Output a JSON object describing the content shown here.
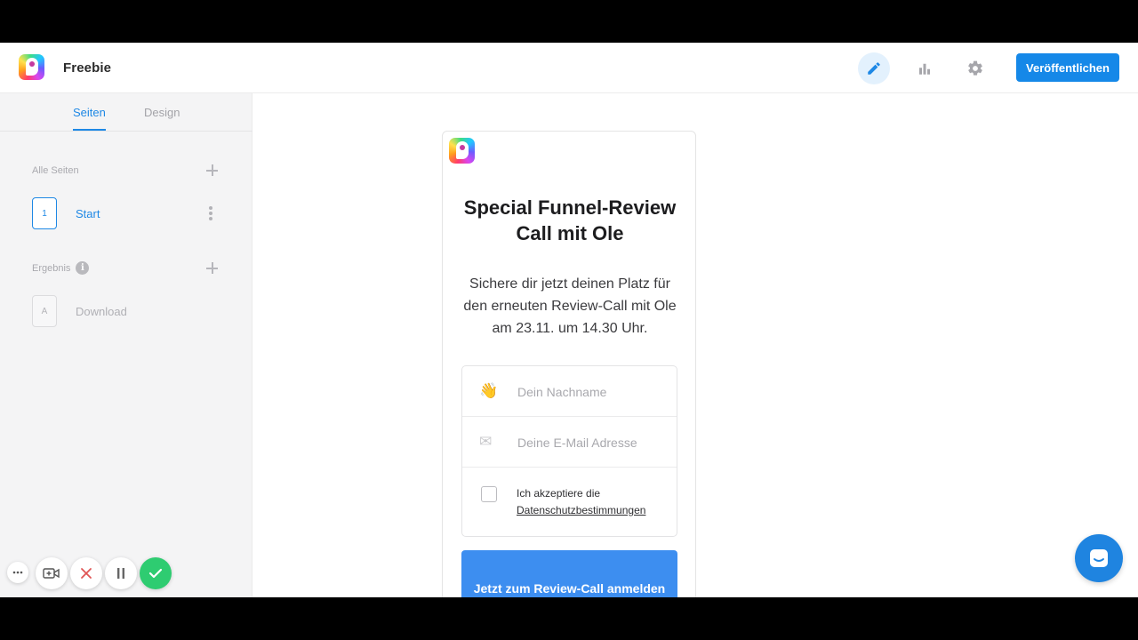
{
  "header": {
    "project_name": "Freebie",
    "publish_label": "Veröffentlichen",
    "icons": [
      "edit-icon",
      "chart-icon",
      "gear-icon"
    ],
    "accent": "#1588e8"
  },
  "sidebar": {
    "tabs": [
      {
        "label": "Seiten",
        "active": true
      },
      {
        "label": "Design",
        "active": false
      }
    ],
    "pages_section": {
      "label": "Alle Seiten"
    },
    "pages": [
      {
        "badge": "1",
        "label": "Start",
        "active": true
      }
    ],
    "result_section": {
      "label": "Ergebnis"
    },
    "results": [
      {
        "badge": "A",
        "label": "Download",
        "active": false
      }
    ]
  },
  "funnel": {
    "title": "Special Funnel-Review Call mit Ole",
    "subtitle": "Sichere dir jetzt deinen Platz für den erneuten Review-Call mit Ole am 23.11. um 14.30 Uhr.",
    "name_field": {
      "icon": "waving-hand-icon",
      "placeholder": "Dein Nachname",
      "value": ""
    },
    "email_field": {
      "icon": "envelope-icon",
      "placeholder": "Deine E-Mail Adresse",
      "value": ""
    },
    "consent": {
      "prefix": "Ich akzeptiere die",
      "link": "Datenschutzbestimmungen",
      "checked": false
    },
    "cta_label": "Jetzt zum Review-Call anmelden",
    "cta_color": "#3d8ef0"
  },
  "chat": {
    "icon": "chat-icon",
    "color": "#1f84e0"
  },
  "recorder": {
    "buttons": [
      "more-icon",
      "camera-add-icon",
      "close-icon",
      "pause-icon",
      "check-icon"
    ],
    "confirm_color": "#2ecc71"
  }
}
